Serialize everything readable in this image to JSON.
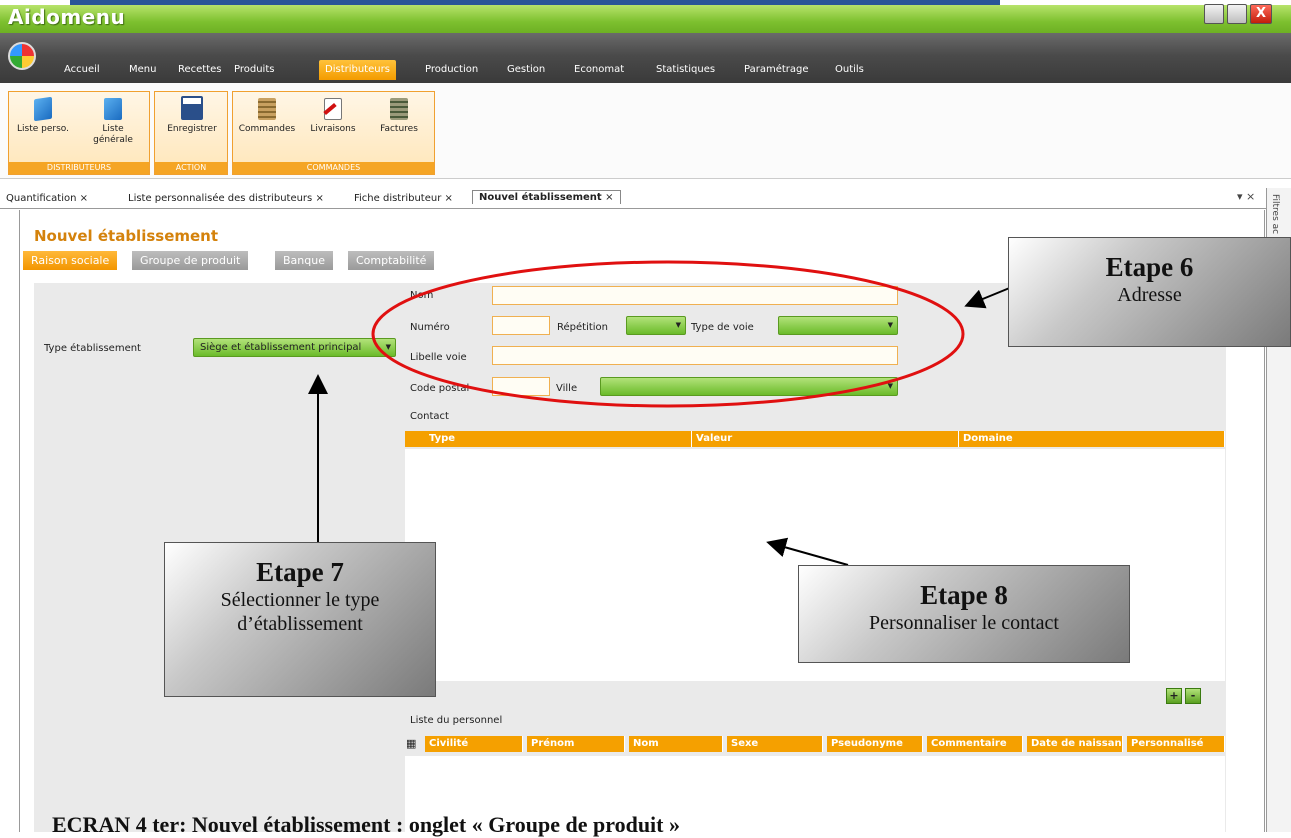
{
  "app": {
    "title": "Aidomenu"
  },
  "window_controls": {
    "minimize": "minimize",
    "restore": "restore",
    "close_glyph": "X"
  },
  "menu": {
    "items": [
      "Accueil",
      "Menu",
      "Recettes",
      "Produits",
      "Distributeurs",
      "Production",
      "Gestion",
      "Economat",
      "Statistiques",
      "Paramétrage",
      "Outils"
    ],
    "active": "Distributeurs"
  },
  "ribbon": {
    "groups": [
      {
        "caption": "DISTRIBUTEURS",
        "buttons": [
          {
            "label": "Liste perso.",
            "icon": "book-blue-icon"
          },
          {
            "label": "Liste générale",
            "icon": "book-blue-icon"
          }
        ]
      },
      {
        "caption": "ACTION",
        "buttons": [
          {
            "label": "Enregistrer",
            "icon": "save-disk-icon"
          }
        ]
      },
      {
        "caption": "COMMANDES",
        "buttons": [
          {
            "label": "Commandes",
            "icon": "notepad-icon"
          },
          {
            "label": "Livraisons",
            "icon": "delivery-note-icon"
          },
          {
            "label": "Factures",
            "icon": "invoice-icon"
          }
        ]
      }
    ]
  },
  "doc_tabs": {
    "tabs": [
      "Quantification",
      "Liste personnalisée des distributeurs",
      "Fiche distributeur",
      "Nouvel établissement"
    ],
    "active": "Nouvel établissement",
    "close_glyph": "×",
    "controls": "▾ ×"
  },
  "right_panel": {
    "label": "Filtres ac"
  },
  "page": {
    "title": "Nouvel établissement",
    "subtabs": [
      "Raison sociale",
      "Groupe de produit",
      "Banque",
      "Comptabilité"
    ],
    "active_subtab": "Raison sociale"
  },
  "form": {
    "type_etablissement_label": "Type établissement",
    "type_etablissement_value": "Siège et établissement principal",
    "nom_label": "Nom",
    "numero_label": "Numéro",
    "repetition_label": "Répétition",
    "type_voie_label": "Type de voie",
    "libelle_voie_label": "Libelle voie",
    "code_postal_label": "Code postal",
    "ville_label": "Ville",
    "contact_label": "Contact",
    "contact_columns": [
      "Type",
      "Valeur",
      "Domaine"
    ],
    "personnel_label": "Liste du personnel",
    "personnel_columns": [
      "Civilité",
      "Prénom",
      "Nom",
      "Sexe",
      "Pseudonyme",
      "Commentaire",
      "Date de naissan",
      "Personnalisé"
    ],
    "add_glyph": "+",
    "remove_glyph": "-"
  },
  "annotations": {
    "etape6": {
      "title": "Etape 6",
      "text": "Adresse"
    },
    "etape7": {
      "title": "Etape 7",
      "text_line1": "Sélectionner le type",
      "text_line2": "d’établissement"
    },
    "etape8": {
      "title": "Etape 8",
      "text": "Personnaliser le contact"
    },
    "caption": "ECRAN 4 ter: Nouvel établissement : onglet « Groupe de produit »"
  },
  "colors": {
    "accent_orange": "#f5a000",
    "title_green": "#7dc02f",
    "ellipse_red": "#e01010"
  }
}
